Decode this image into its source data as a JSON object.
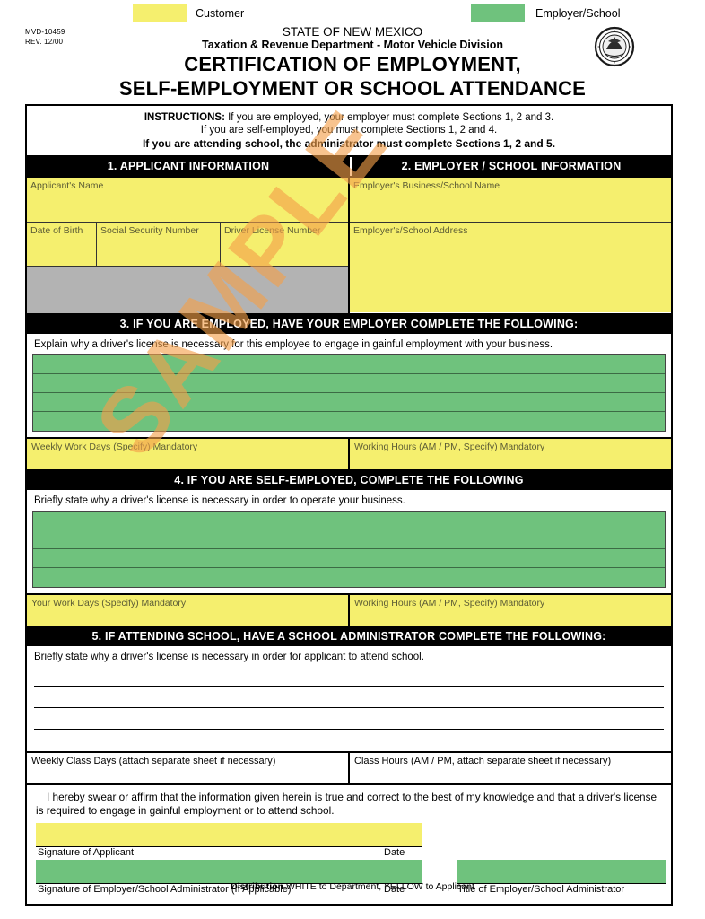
{
  "legend": {
    "customer": {
      "label": "Customer",
      "color": "#f5ef6e"
    },
    "employer": {
      "label": "Employer/School",
      "color": "#6fc27d"
    }
  },
  "header": {
    "form_number": "MVD-10459",
    "revision": "REV. 12/00",
    "state_line": "STATE OF NEW MEXICO",
    "department_line": "Taxation & Revenue Department - Motor Vehicle Division",
    "title_line1": "CERTIFICATION OF EMPLOYMENT,",
    "title_line2": "SELF-EMPLOYMENT OR SCHOOL ATTENDANCE",
    "seal_icon": "state-seal-icon"
  },
  "instructions": {
    "label": "INSTRUCTIONS:",
    "line1": "If you are employed, your employer must complete Sections 1, 2 and 3.",
    "line2": "If you are self-employed, you must complete Sections 1, 2 and 4.",
    "line3": "If you are attending school, the administrator must complete Sections 1, 2 and 5."
  },
  "section1": {
    "heading": "1. APPLICANT INFORMATION",
    "fields": {
      "applicant_name": "Applicant's Name",
      "date_of_birth": "Date of Birth",
      "social_security_number": "Social Security Number",
      "driver_license_number": "Driver License Number"
    }
  },
  "section2": {
    "heading": "2. EMPLOYER / SCHOOL INFORMATION",
    "fields": {
      "business_school_name": "Employer's Business/School Name",
      "address": "Employer's/School Address"
    }
  },
  "section3": {
    "heading": "3. IF YOU ARE EMPLOYED, HAVE YOUR EMPLOYER COMPLETE THE FOLLOWING:",
    "prompt": "Explain why a driver's license is necessary for this employee to engage in gainful employment with your business.",
    "work_days": "Weekly Work Days (Specify) Mandatory",
    "working_hours": "Working Hours (AM / PM, Specify) Mandatory"
  },
  "section4": {
    "heading": "4. IF YOU ARE SELF-EMPLOYED, COMPLETE THE FOLLOWING",
    "prompt": "Briefly state why a driver's license is necessary in order to operate your business.",
    "work_days": "Your Work Days (Specify) Mandatory",
    "working_hours": "Working Hours (AM / PM, Specify) Mandatory"
  },
  "section5": {
    "heading": "5. IF ATTENDING SCHOOL, HAVE A SCHOOL ADMINISTRATOR COMPLETE THE FOLLOWING:",
    "prompt": "Briefly state why a driver's license is necessary in order for applicant to attend school.",
    "class_days": "Weekly Class Days (attach separate sheet if necessary)",
    "class_hours": "Class Hours (AM / PM, attach separate sheet if necessary)"
  },
  "affirmation": {
    "text": "I hereby swear or affirm that the information given herein is true and correct to the best of my knowledge and that a driver's license is required to engage in gainful employment or to attend school.",
    "signature_applicant": "Signature of Applicant",
    "date1": "Date",
    "signature_employer": "Signature of Employer/School Administrator",
    "signature_employer_note": "(If Applicable)",
    "date2": "Date",
    "title_employer": "Title of Employer/School Administrator"
  },
  "footer": {
    "distribution_label": "Distribution",
    "distribution_text": "WHITE to Department, YELLOW to Applicant"
  },
  "watermark": {
    "text": "SAMPLE",
    "color": "#f4a04a"
  }
}
